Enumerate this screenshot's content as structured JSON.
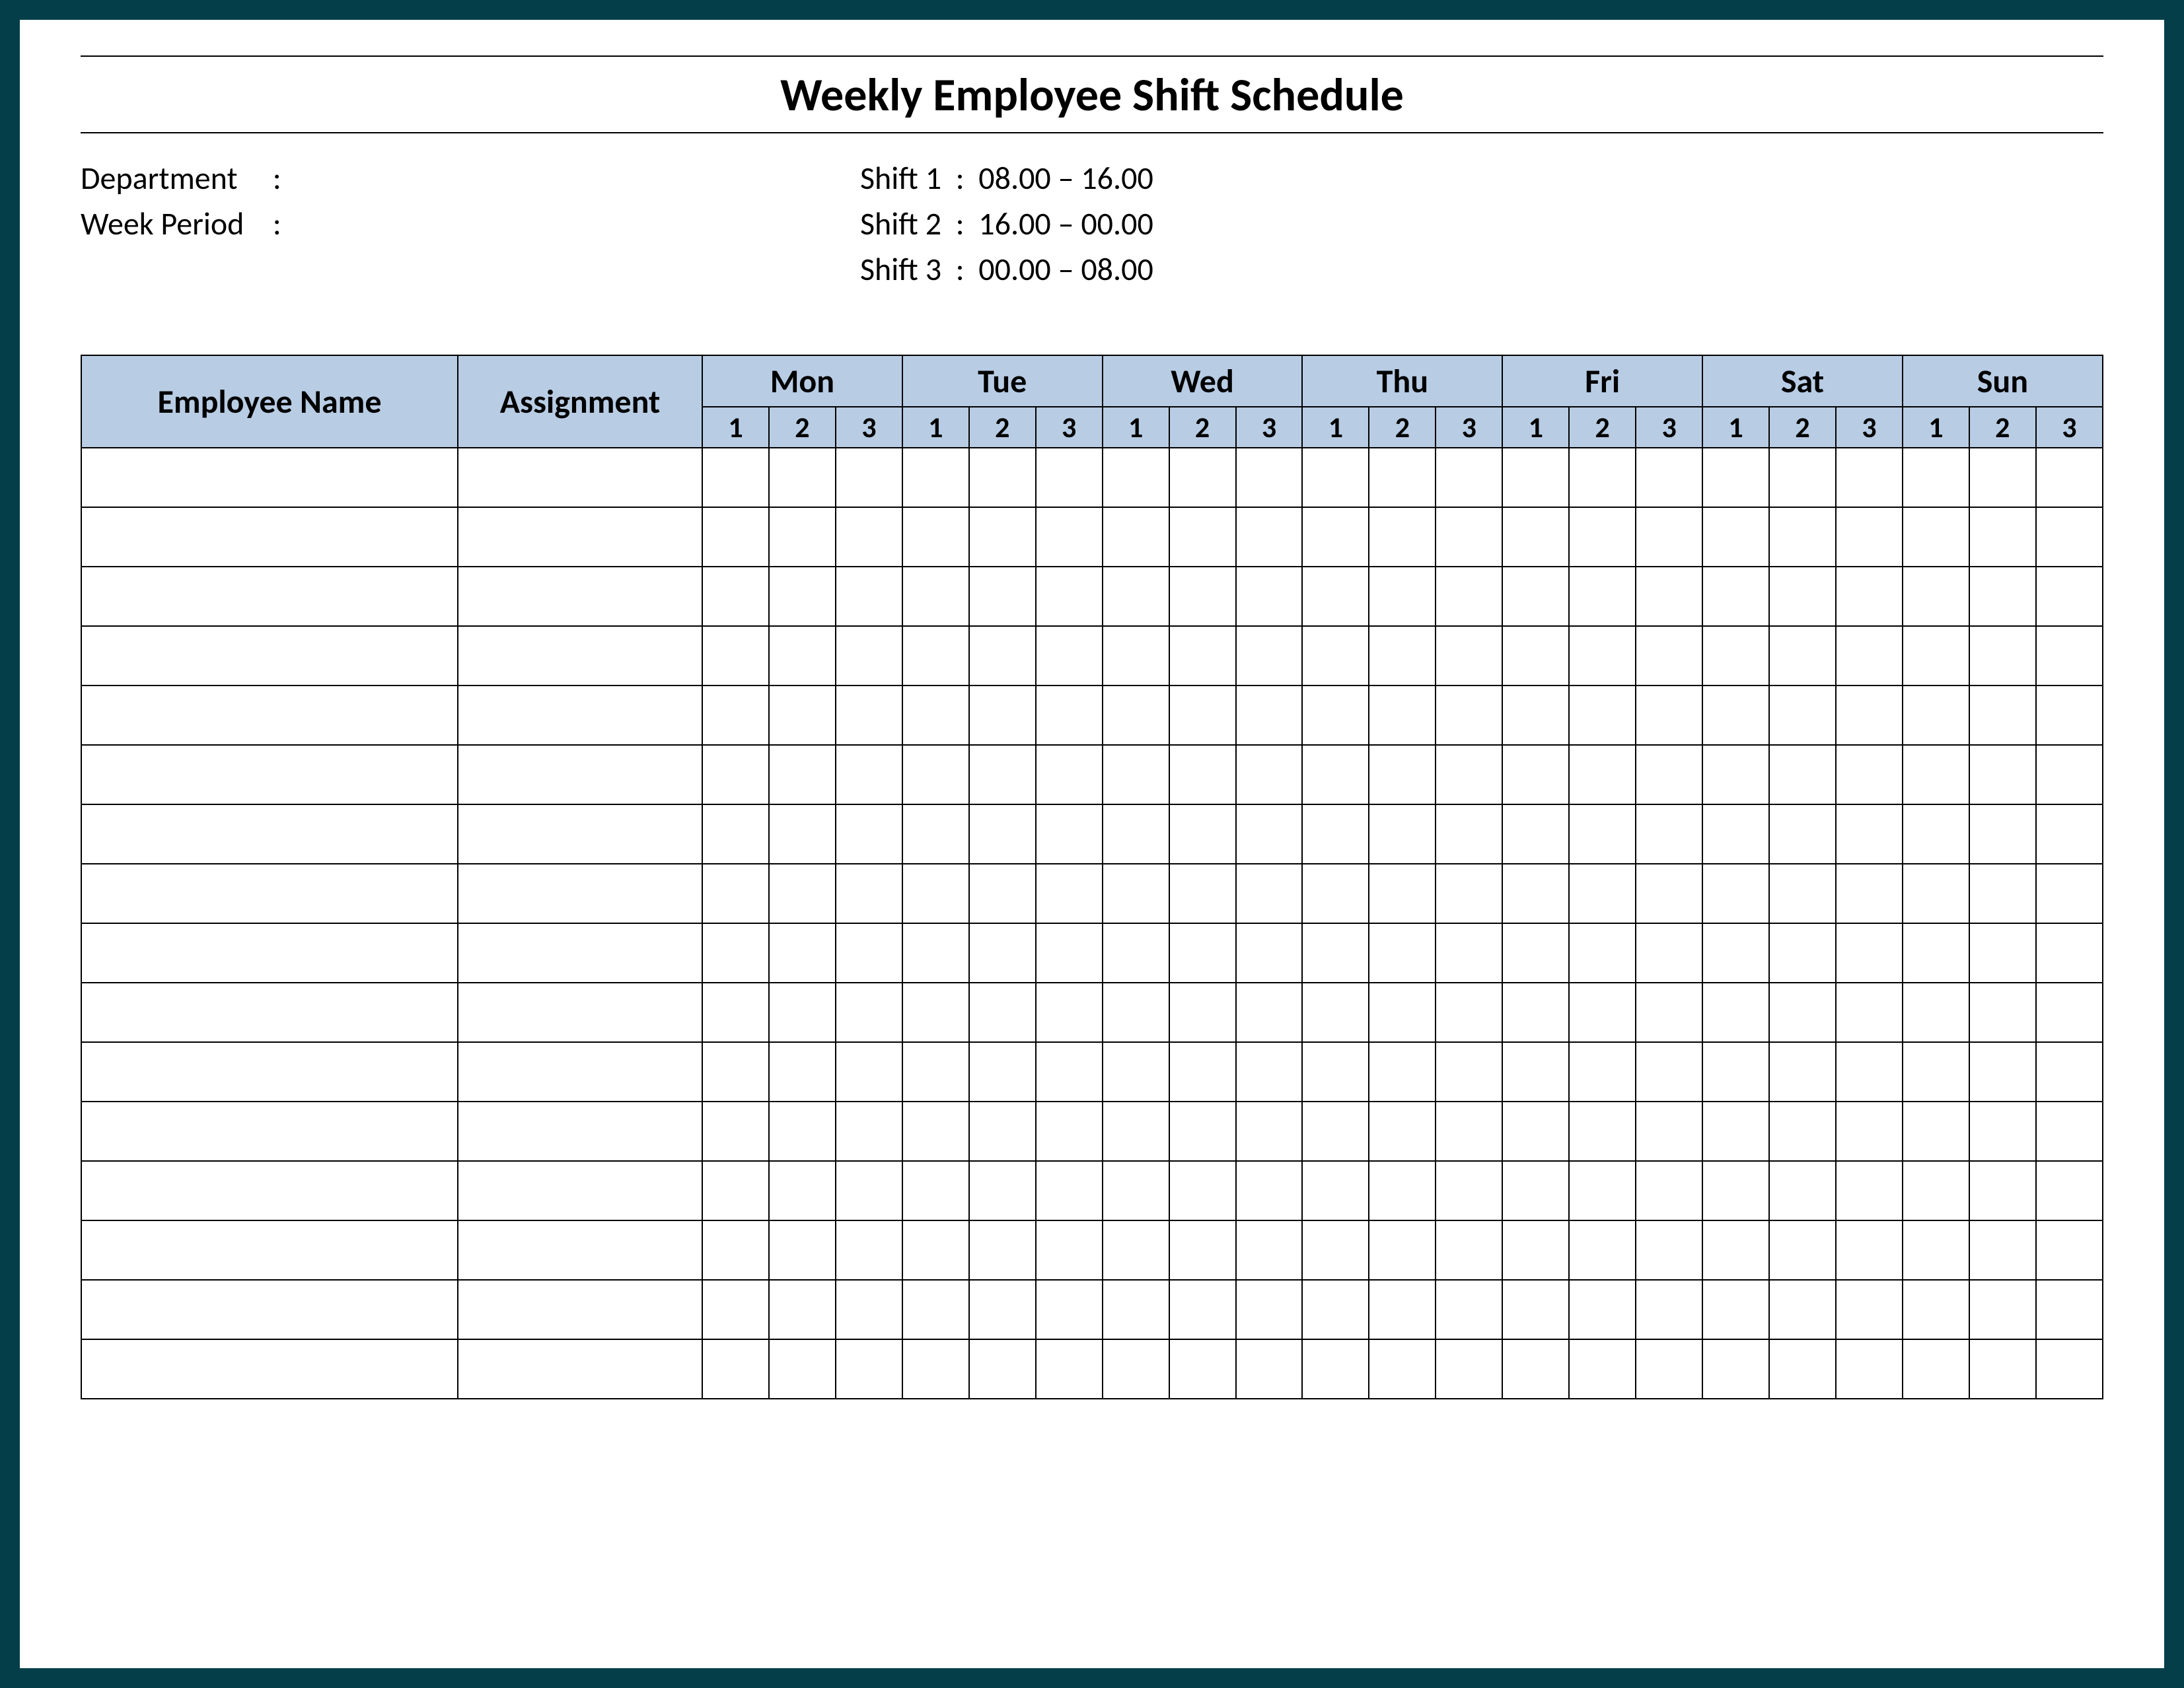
{
  "title": "Weekly Employee Shift Schedule",
  "meta": {
    "department_label": "Department",
    "week_period_label": "Week  Period",
    "department_value": "",
    "week_period_value": "",
    "shifts": [
      {
        "label": "Shift 1",
        "time": "08.00  – 16.00"
      },
      {
        "label": "Shift 2",
        "time": "16.00  – 00.00"
      },
      {
        "label": "Shift 3",
        "time": "00.00  – 08.00"
      }
    ]
  },
  "table": {
    "employee_header": "Employee Name",
    "assignment_header": "Assignment",
    "days": [
      "Mon",
      "Tue",
      "Wed",
      "Thu",
      "Fri",
      "Sat",
      "Sun"
    ],
    "shift_numbers": [
      "1",
      "2",
      "3"
    ],
    "row_count": 16
  }
}
